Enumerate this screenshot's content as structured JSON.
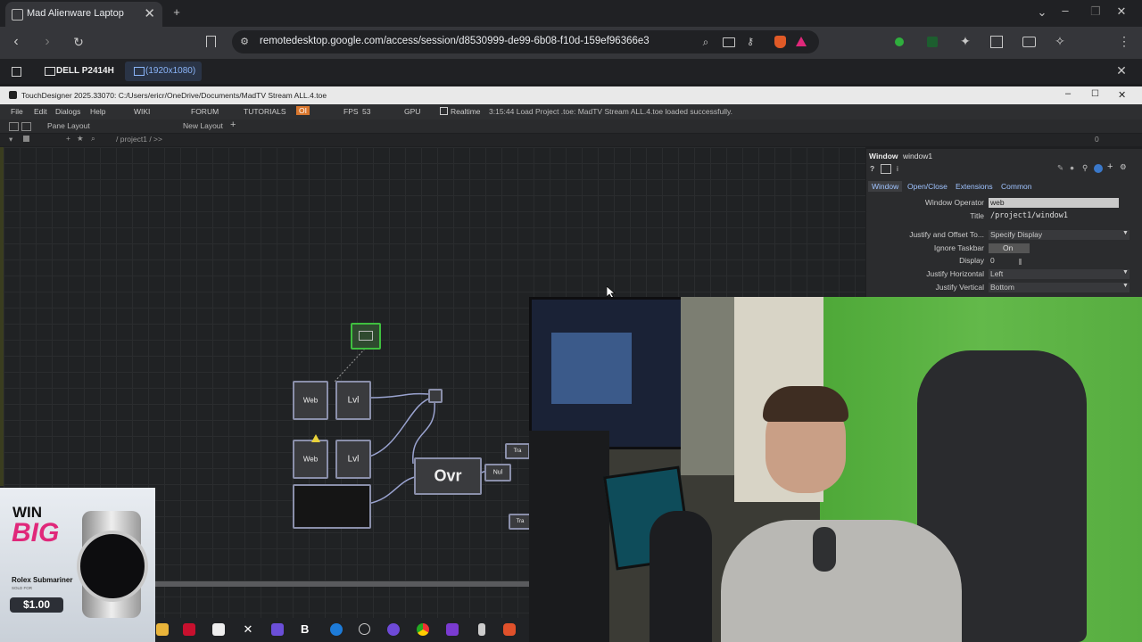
{
  "browser": {
    "tab_title": "Mad Alienware Laptop",
    "new_tab": "+",
    "url": "remotedesktop.google.com/access/session/d8530999-de99-6b08-f10d-159ef96366e3"
  },
  "remote_desktop": {
    "monitor_name": "DELL P2414H",
    "resolution": "(1920x1080)"
  },
  "touchdesigner": {
    "window_title": "TouchDesigner 2025.33070: C:/Users/ericr/OneDrive/Documents/MadTV Stream ALL.4.toe",
    "menu": [
      "File",
      "Edit",
      "Dialogs",
      "Help"
    ],
    "links": [
      "WIKI",
      "FORUM",
      "TUTORIALS"
    ],
    "oi": "OI",
    "fps_label": "FPS",
    "fps_value": "53",
    "gpu": "GPU",
    "realtime": "Realtime",
    "status_message": "3:15:44 Load Project .toe: MadTV Stream ALL.4.toe loaded successfully.",
    "pane_layout": "Pane Layout",
    "new_layout": "New Layout",
    "path": "/ project1 / >>",
    "pane_index": "0",
    "operators": {
      "web1": "Web",
      "lvl1": "Lvl",
      "web2": "Web",
      "lvl2": "Lvl",
      "over": "Ovr",
      "null": "Nul",
      "tr1": "Tra",
      "tr2": "Tra"
    },
    "params": {
      "op_type": "Window",
      "op_name": "window1",
      "tabs": [
        "Window",
        "Open/Close",
        "Extensions",
        "Common"
      ],
      "rows": [
        {
          "label": "Window Operator",
          "value": "web"
        },
        {
          "label": "Title",
          "value": "/project1/window1"
        },
        {
          "label": "Justify and Offset To...",
          "value": "Specify Display"
        },
        {
          "label": "Ignore Taskbar",
          "value": "On"
        },
        {
          "label": "Display",
          "value": "0"
        },
        {
          "label": "Justify Horizontal",
          "value": "Left"
        },
        {
          "label": "Justify Vertical",
          "value": "Bottom"
        }
      ]
    }
  },
  "ad": {
    "headline1": "WIN",
    "headline2": "BIG",
    "product": "Rolex Submariner",
    "sold_for": "SOLD FOR",
    "price": "$1.00"
  },
  "colors": {
    "chrome_bg": "#202124",
    "td_bg": "#1e1f21",
    "accent_pink": "#e0287a",
    "selected_op": "#3fbf3f"
  }
}
